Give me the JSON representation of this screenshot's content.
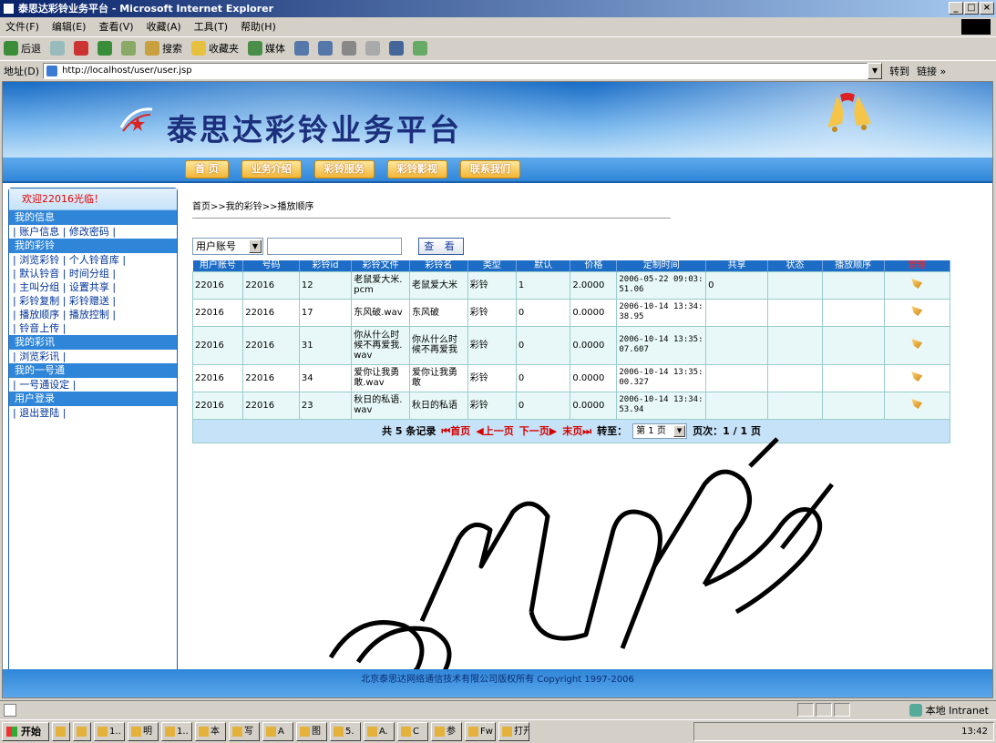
{
  "window": {
    "title": "泰思达彩铃业务平台 - Microsoft Internet Explorer",
    "controls": [
      "_",
      "□",
      "×"
    ]
  },
  "menu": [
    "文件(F)",
    "编辑(E)",
    "查看(V)",
    "收藏(A)",
    "工具(T)",
    "帮助(H)"
  ],
  "toolbar": {
    "back": "后退",
    "search": "搜索",
    "favorites": "收藏夹",
    "media": "媒体"
  },
  "address": {
    "label": "地址(D)",
    "url": "http://localhost/user/user.jsp",
    "go": "转到",
    "links": "链接 »"
  },
  "site": {
    "title": "泰思达彩铃业务平台",
    "nav": [
      "首 页",
      "业务介绍",
      "彩铃服务",
      "彩铃影视",
      "联系我们"
    ]
  },
  "sidebar": {
    "welcome": "欢迎22016光临！",
    "sections": [
      {
        "head": "我的信息",
        "rows": [
          "| 账户信息 | 修改密码 |"
        ]
      },
      {
        "head": "我的彩铃",
        "rows": [
          "| 浏览彩铃 | 个人铃音库 |",
          "| 默认铃音 | 时间分组 |",
          "| 主叫分组 | 设置共享 |",
          "| 彩铃复制 | 彩铃赠送 |",
          "| 播放顺序 | 播放控制 |",
          "| 铃音上传 |"
        ]
      },
      {
        "head": "我的彩讯",
        "rows": [
          "| 浏览彩讯 |"
        ]
      },
      {
        "head": "我的一号通",
        "rows": [
          "| 一号通设定 |"
        ]
      },
      {
        "head": "用户登录",
        "rows": [
          "| 退出登陆 |"
        ]
      }
    ]
  },
  "breadcrumb": "首页>>我的彩铃>>播放顺序",
  "search": {
    "field_select": "用户账号",
    "value": "",
    "button": "查 看"
  },
  "table": {
    "headers": [
      "用户账号",
      "号码",
      "彩铃id",
      "彩铃文件",
      "彩铃名",
      "类型",
      "默认",
      "价格",
      "定制时间",
      "共享",
      "状态",
      "播放顺序",
      "管理"
    ],
    "rows": [
      [
        "22016",
        "22016",
        "12",
        "老鼠爱大米.pcm",
        "老鼠爱大米",
        "彩铃",
        "1",
        "2.0000",
        "2006-05-22 09:03:51.06",
        "0",
        "",
        "",
        ""
      ],
      [
        "22016",
        "22016",
        "17",
        "东风破.wav",
        "东风破",
        "彩铃",
        "0",
        "0.0000",
        "2006-10-14 13:34:38.95",
        "",
        "",
        "",
        ""
      ],
      [
        "22016",
        "22016",
        "31",
        "你从什么时候不再爱我.wav",
        "你从什么时候不再爱我",
        "彩铃",
        "0",
        "0.0000",
        "2006-10-14 13:35:07.607",
        "",
        "",
        "",
        ""
      ],
      [
        "22016",
        "22016",
        "34",
        "爱你让我勇敢.wav",
        "爱你让我勇敢",
        "彩铃",
        "0",
        "0.0000",
        "2006-10-14 13:35:00.327",
        "",
        "",
        "",
        ""
      ],
      [
        "22016",
        "22016",
        "23",
        "秋日的私语.wav",
        "秋日的私语",
        "彩铃",
        "0",
        "0.0000",
        "2006-10-14 13:34:53.94",
        "",
        "",
        "",
        ""
      ]
    ]
  },
  "pager": {
    "total": "共 5 条记录",
    "first": "⏮首页",
    "prev": "◀上一页",
    "next": "下一页▶",
    "last": "末页⏭",
    "goto": "转至：",
    "page_sel": "第 1 页",
    "pages": "页次：1 / 1 页"
  },
  "footer": "北京泰思达网络通信技术有限公司版权所有 Copyright 1997-2006",
  "status": {
    "zone": "本地 Intranet"
  },
  "taskbar": {
    "start": "开始",
    "tasks": [
      "1..",
      "明",
      "1..",
      "本",
      "写",
      "A",
      "图",
      "5.",
      "A.",
      "C",
      "参",
      "Fw",
      "打开"
    ],
    "clock": "13:42"
  }
}
